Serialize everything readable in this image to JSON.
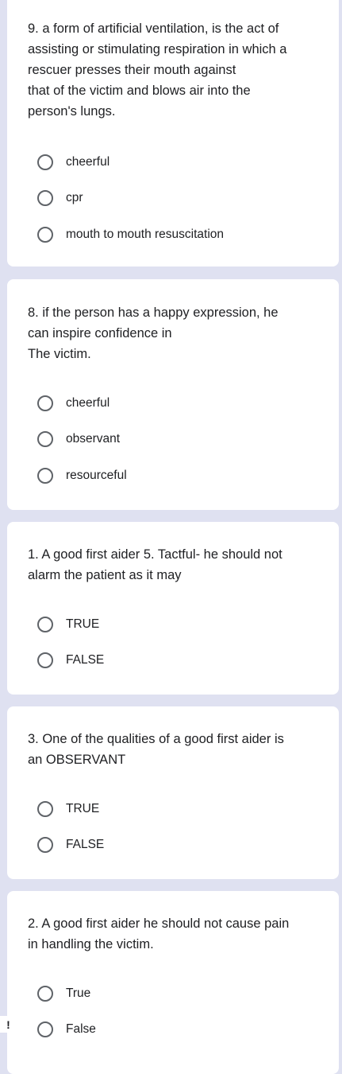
{
  "questions": [
    {
      "text": "9. a form of artificial ventilation, is the act of\nassisting or stimulating respiration in which a\nrescuer presses their mouth against\nthat of the victim and blows air into the\nperson's lungs.",
      "options": [
        "cheerful",
        "cpr",
        "mouth to mouth resuscitation"
      ]
    },
    {
      "text": "8. if the person has a happy expression, he\ncan inspire confidence in\nThe victim.",
      "options": [
        "cheerful",
        "observant",
        "resourceful"
      ]
    },
    {
      "text": "1.  A good first aider 5. Tactful- he should not\nalarm the patient as it may",
      "options": [
        "TRUE",
        "FALSE"
      ]
    },
    {
      "text": "3. One of the qualities of a good first aider is\nan OBSERVANT",
      "options": [
        "TRUE",
        "FALSE"
      ]
    },
    {
      "text": "2. A good first aider he should not cause pain\nin handling the victim.",
      "options": [
        "True",
        "False"
      ]
    }
  ],
  "required_flag_icon": "!"
}
